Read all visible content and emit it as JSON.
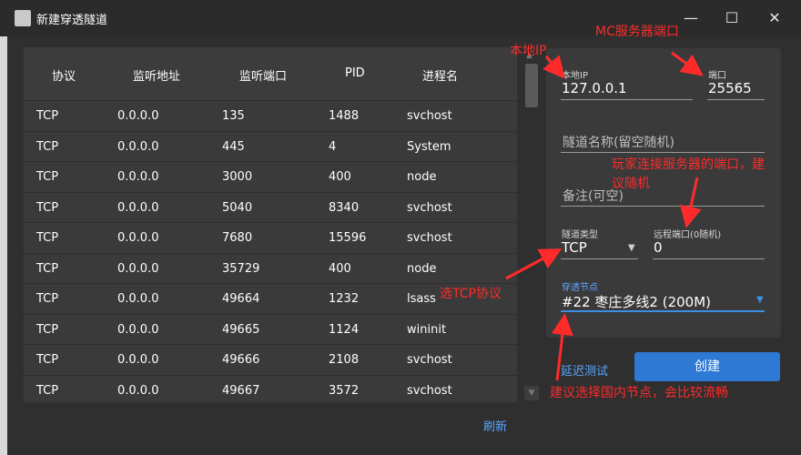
{
  "window": {
    "title": "新建穿透隧道",
    "min_glyph": "—",
    "max_glyph": "☐",
    "close_glyph": "✕"
  },
  "table": {
    "headers": [
      "协议",
      "监听地址",
      "监听端口",
      "PID",
      "进程名"
    ],
    "rows": [
      [
        "TCP",
        "0.0.0.0",
        "135",
        "1488",
        "svchost"
      ],
      [
        "TCP",
        "0.0.0.0",
        "445",
        "4",
        "System"
      ],
      [
        "TCP",
        "0.0.0.0",
        "3000",
        "400",
        "node"
      ],
      [
        "TCP",
        "0.0.0.0",
        "5040",
        "8340",
        "svchost"
      ],
      [
        "TCP",
        "0.0.0.0",
        "7680",
        "15596",
        "svchost"
      ],
      [
        "TCP",
        "0.0.0.0",
        "35729",
        "400",
        "node"
      ],
      [
        "TCP",
        "0.0.0.0",
        "49664",
        "1232",
        "lsass"
      ],
      [
        "TCP",
        "0.0.0.0",
        "49665",
        "1124",
        "wininit"
      ],
      [
        "TCP",
        "0.0.0.0",
        "49666",
        "2108",
        "svchost"
      ],
      [
        "TCP",
        "0.0.0.0",
        "49667",
        "3572",
        "svchost"
      ]
    ]
  },
  "form": {
    "local_ip": {
      "label": "本地IP",
      "value": "127.0.0.1"
    },
    "port": {
      "label": "端口",
      "value": "25565"
    },
    "tunnel_name": {
      "placeholder": "隧道名称(留空随机)"
    },
    "note": {
      "placeholder": "备注(可空)"
    },
    "tunnel_type": {
      "label": "隧道类型",
      "value": "TCP"
    },
    "remote_port": {
      "label": "远程端口(0随机)",
      "value": "0"
    },
    "node": {
      "label": "穿透节点",
      "value": "#22 枣庄多线2 (200M)"
    }
  },
  "actions": {
    "latency_test": "延迟测试",
    "create": "创建",
    "refresh": "刷新"
  },
  "annotations": {
    "local_ip": "本地IP",
    "mc_port": "MC服务器端口",
    "remote_port_line1": "玩家连接服务器的端口，建",
    "remote_port_line2": "议随机",
    "tcp": "选TCP协议",
    "node": "建议选择国内节点，会比较流畅"
  },
  "colors": {
    "accent": "#2d79d4",
    "link": "#5aa6ff",
    "annotation": "#ff2b2b",
    "panel": "#3a3a3a"
  }
}
